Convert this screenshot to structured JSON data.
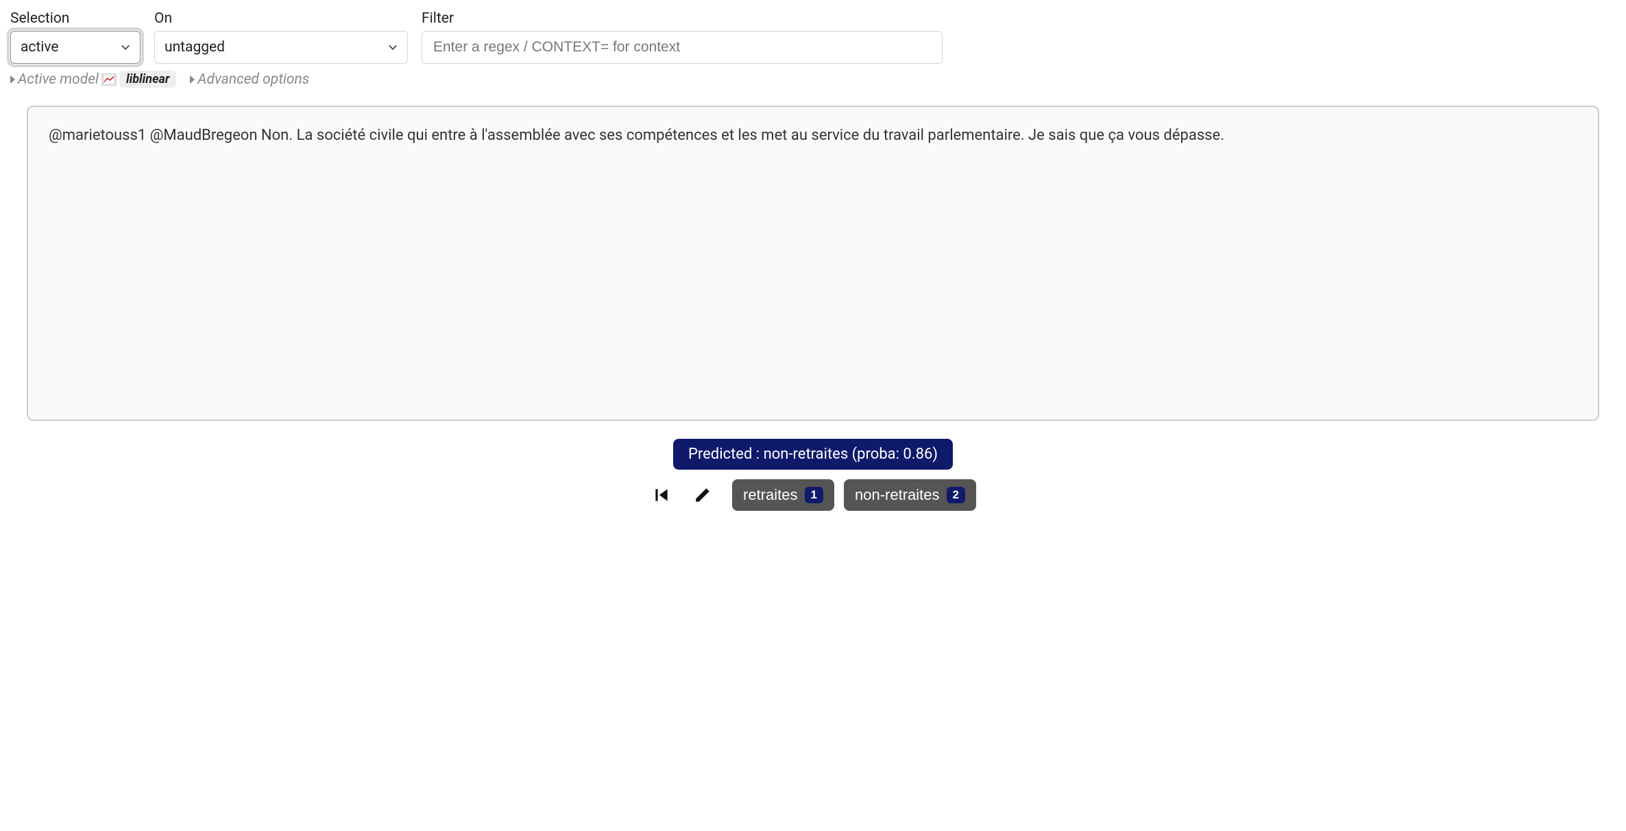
{
  "controls": {
    "selection": {
      "label": "Selection",
      "value": "active"
    },
    "on": {
      "label": "On",
      "value": "untagged"
    },
    "filter": {
      "label": "Filter",
      "placeholder": "Enter a regex / CONTEXT= for context",
      "value": ""
    }
  },
  "options": {
    "active_model_label": "Active model",
    "model_name": "liblinear",
    "advanced_label": "Advanced options"
  },
  "document": {
    "text": "@marietouss1 @MaudBregeon Non. La société civile qui entre à l'assemblée avec ses compétences et les met au service du travail parlementaire. Je sais que ça vous dépasse."
  },
  "prediction": {
    "text": "Predicted : non-retraites (proba: 0.86)"
  },
  "tags": [
    {
      "label": "retraites",
      "key": "1"
    },
    {
      "label": "non-retraites",
      "key": "2"
    }
  ]
}
